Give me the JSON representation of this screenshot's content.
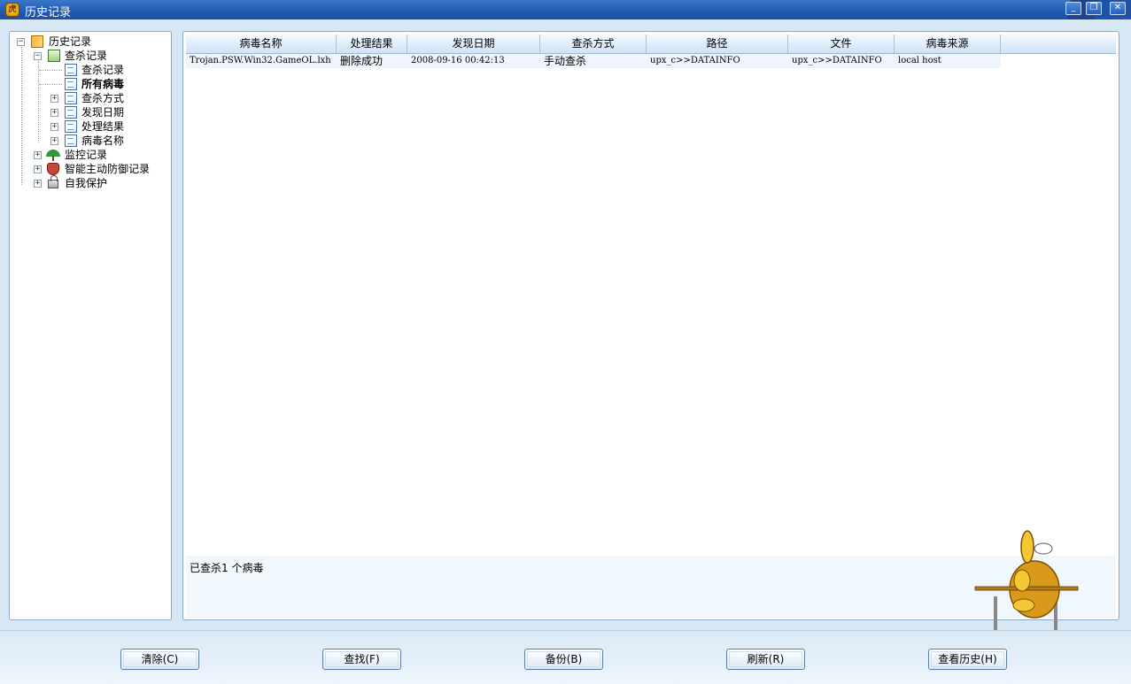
{
  "window": {
    "title": "历史记录",
    "icon": "tiger-app-icon",
    "controls": {
      "minimize": "_",
      "restore": "❐",
      "close": "✕"
    }
  },
  "tree": {
    "root": {
      "label": "历史记录",
      "expander": "−",
      "icon": "book-icon"
    },
    "scan_records": {
      "label": "查杀记录",
      "expander": "−",
      "icon": "scan-icon",
      "children": [
        {
          "label": "查杀记录",
          "icon": "document-icon",
          "expander": ""
        },
        {
          "label": "所有病毒",
          "icon": "document-icon",
          "expander": "",
          "selected": true
        },
        {
          "label": "查杀方式",
          "icon": "document-icon",
          "expander": "+"
        },
        {
          "label": "发现日期",
          "icon": "document-icon",
          "expander": "+"
        },
        {
          "label": "处理结果",
          "icon": "document-icon",
          "expander": "+"
        },
        {
          "label": "病毒名称",
          "icon": "document-icon",
          "expander": "+"
        }
      ]
    },
    "others": [
      {
        "label": "监控记录",
        "icon": "umbrella-icon",
        "expander": "+"
      },
      {
        "label": "智能主动防御记录",
        "icon": "shield-icon",
        "expander": "+"
      },
      {
        "label": "自我保护",
        "icon": "lock-icon",
        "expander": "+"
      }
    ]
  },
  "table": {
    "columns": [
      "病毒名称",
      "处理结果",
      "发现日期",
      "查杀方式",
      "路径",
      "文件",
      "病毒来源"
    ],
    "rows": [
      {
        "virus_name": "Trojan.PSW.Win32.GameOL.lxh",
        "result": "删除成功",
        "date": "2008-09-16 00:42:13",
        "method": "手动查杀",
        "path": "upx_c>>DATAINFO",
        "file": "upx_c>>DATAINFO",
        "source": "local host"
      }
    ]
  },
  "status": {
    "text": "已查杀1 个病毒"
  },
  "buttons": {
    "clear": "清除(C)",
    "find": "查找(F)",
    "backup": "备份(B)",
    "refresh": "刷新(R)",
    "view_history": "查看历史(H)"
  },
  "mascot": {
    "icon": "rising-lion-mascot-icon"
  },
  "colors": {
    "titlebar": "#2159b3",
    "background": "#d8e7f4",
    "header": "#cfe2f6",
    "row_highlight": "#eef5fd"
  }
}
